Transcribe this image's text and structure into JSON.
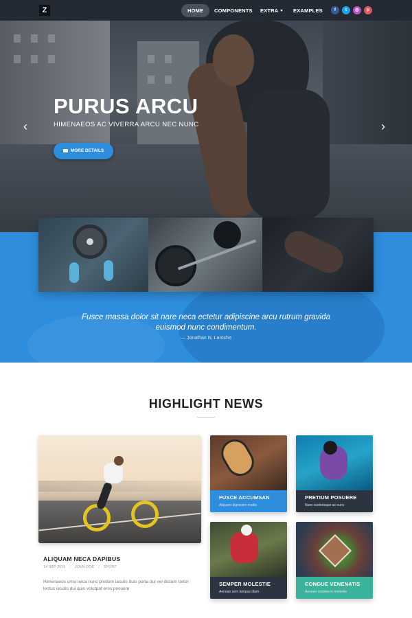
{
  "nav": {
    "brand": "Z",
    "items": [
      {
        "label": "HOME"
      },
      {
        "label": "COMPONENTS"
      },
      {
        "label": "EXTRA"
      },
      {
        "label": "EXAMPLES"
      }
    ],
    "social": [
      {
        "icon": "facebook-icon",
        "glyph": "f",
        "color": "#3b5998"
      },
      {
        "icon": "twitter-icon",
        "glyph": "t",
        "color": "#1da1f2"
      },
      {
        "icon": "instagram-icon",
        "glyph": "◎",
        "color": "#b553c7"
      },
      {
        "icon": "pinterest-icon",
        "glyph": "p",
        "color": "#e0585a"
      }
    ]
  },
  "hero": {
    "title": "PURUS ARCU",
    "subtitle": "HIMENAEOS AC VIVERRA ARCU NEC NUNC",
    "button_label": "MORE DETAILS"
  },
  "testimonial": {
    "quote": "Fusce massa dolor sit nare neca ectetur adipiscine arcu rutrum gravida euismod nunc condimentum.",
    "author": "— Jonathan N. Laroche"
  },
  "news": {
    "title": "HIGHLIGHT NEWS",
    "feature": {
      "title": "ALIQUAM NECA DAPIBUS",
      "date": "14 SEP 2019",
      "author": "JOHN DOE",
      "category": "SPORT",
      "text": "Himenaeos urna neca nunc pretium iaculis duis porta dui vel dictum tortor lectus iaculis dui quis volutpat eros posuere"
    },
    "cards": [
      {
        "title": "FUSCE ACCUMSAN",
        "subtitle": "Aliquam dignissim mattis",
        "color": "#2e8ddc"
      },
      {
        "title": "PRETIUM POSUERE",
        "subtitle": "Nunc scelerisque ac nunc",
        "color": "#2b3440"
      },
      {
        "title": "SEMPER MOLESTIE",
        "subtitle": "Aenean sem tempus diam",
        "color": "#2b3440"
      },
      {
        "title": "CONGUE VENENATIS",
        "subtitle": "Aenean sodales in molestie",
        "color": "#3bb29a"
      }
    ]
  }
}
